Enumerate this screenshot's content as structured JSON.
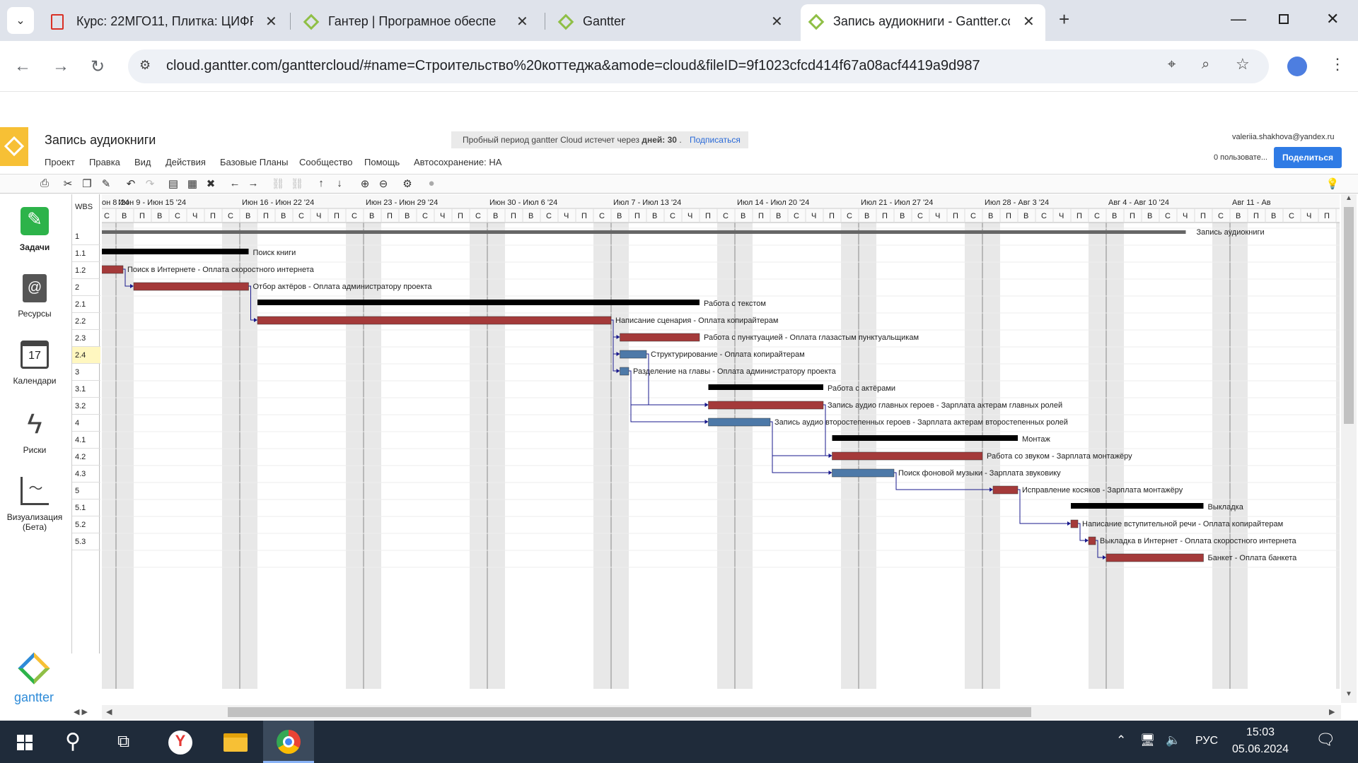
{
  "browser": {
    "tabs": [
      {
        "title": "Курс: 22МГО11, Плитка: ЦИФР",
        "icon": "document-icon"
      },
      {
        "title": "Гантер | Програмное обеспе",
        "icon": "gantter-icon"
      },
      {
        "title": "Gantter",
        "icon": "gantter-icon"
      },
      {
        "title": "Запись аудиокниги - Gantter.co",
        "icon": "gantter-icon"
      }
    ],
    "new_tab": "+",
    "url": "cloud.gantter.com/ganttercloud/#name=Строительство%20коттеджа&amode=cloud&fileID=9f1023cfcd414f67a08acf4419a9d987"
  },
  "app": {
    "title": "Запись аудиокниги",
    "trial_text": "Пробный период gantter Cloud истечет через",
    "trial_days_label": "дней: 30",
    "trial_dot": ".",
    "subscribe": "Подписаться",
    "user_email": "valeriia.shakhova@yandex.ru",
    "users_label": "0 пользовате...",
    "share": "Поделиться",
    "menu": [
      "Проект",
      "Правка",
      "Вид",
      "Действия",
      "Базовые Планы",
      "Сообщество",
      "Помощь"
    ],
    "autosave": "Автосохранение: НА",
    "brand": "gantter"
  },
  "sidenav": [
    {
      "label": "Задачи",
      "icon": "edit-icon"
    },
    {
      "label": "Ресурсы",
      "icon": "contacts-icon"
    },
    {
      "label": "Календари",
      "icon": "calendar-icon",
      "day": "17"
    },
    {
      "label": "Риски",
      "icon": "lightning-icon"
    },
    {
      "label": "Визуализация",
      "label2": "(Бета)",
      "icon": "chart-icon"
    }
  ],
  "wbs": {
    "header": "WBS",
    "rows": [
      "1",
      "1.1",
      "1.2",
      "2",
      "2.1",
      "2.2",
      "2.3",
      "2.4",
      "3",
      "3.1",
      "3.2",
      "4",
      "4.1",
      "4.2",
      "4.3",
      "5",
      "5.1",
      "5.2",
      "5.3"
    ],
    "selected": "2.4"
  },
  "gantt": {
    "weeks": [
      "он 8 '24",
      "Июн 9 - Июн 15 '24",
      "Июн 16 - Июн 22 '24",
      "Июн 23 - Июн 29 '24",
      "Июн 30 - Июл 6 '24",
      "Июл 7 - Июл 13 '24",
      "Июл 14 - Июл 20 '24",
      "Июл 21 - Июл 27 '24",
      "Июл 28 - Авг 3 '24",
      "Авг 4 - Авг 10 '24",
      "Авг 11 - Ав"
    ],
    "day_letters": [
      "В",
      "П",
      "В",
      "С",
      "Ч",
      "П",
      "С"
    ],
    "project_label": "Запись аудиокниги",
    "tasks": [
      {
        "wbs": "1",
        "type": "summary",
        "start": 1,
        "end": 9.5,
        "label": "Поиск книги"
      },
      {
        "wbs": "1.1",
        "type": "task",
        "start": 1,
        "end": 2.4,
        "color": "red",
        "label": "Поиск в Интернете - Оплата скоростного интернета"
      },
      {
        "wbs": "1.2",
        "type": "task",
        "start": 3,
        "end": 9.5,
        "color": "red",
        "label": "Отбор актёров - Оплата администратору проекта"
      },
      {
        "wbs": "2",
        "type": "summary",
        "start": 10,
        "end": 35,
        "label": "Работа с текстом"
      },
      {
        "wbs": "2.1",
        "type": "task",
        "start": 10,
        "end": 30,
        "color": "red",
        "label": "Написание сценария - Оплата копирайтерам"
      },
      {
        "wbs": "2.2",
        "type": "task",
        "start": 30.5,
        "end": 35,
        "color": "red",
        "label": "Работа с пунктуацией - Оплата глазастым пунктуальщикам"
      },
      {
        "wbs": "2.3",
        "type": "task",
        "start": 30.5,
        "end": 32,
        "color": "blue",
        "label": "Структурирование - Оплата копирайтерам"
      },
      {
        "wbs": "2.4",
        "type": "task",
        "start": 30.5,
        "end": 31,
        "color": "blue",
        "label": "Разделение на главы - Оплата администратору проекта"
      },
      {
        "wbs": "3",
        "type": "summary",
        "start": 35.5,
        "end": 42,
        "label": "Работа с актёрами"
      },
      {
        "wbs": "3.1",
        "type": "task",
        "start": 35.5,
        "end": 42,
        "color": "red",
        "label": "Запись аудио главных героев - Зарплата актерам главных ролей"
      },
      {
        "wbs": "3.2",
        "type": "task",
        "start": 35.5,
        "end": 39,
        "color": "blue",
        "label": "Запись аудио второстепенных героев - Зарплата актерам второстепенных ролей"
      },
      {
        "wbs": "4",
        "type": "summary",
        "start": 42.5,
        "end": 53,
        "label": "Монтаж"
      },
      {
        "wbs": "4.1",
        "type": "task",
        "start": 42.5,
        "end": 51,
        "color": "red",
        "label": "Работа со звуком - Зарплата монтажёру"
      },
      {
        "wbs": "4.2",
        "type": "task",
        "start": 42.5,
        "end": 46,
        "color": "blue",
        "label": "Поиск фоновой музыки - Зарплата звуковику"
      },
      {
        "wbs": "4.3",
        "type": "task",
        "start": 51.6,
        "end": 53,
        "color": "red",
        "label": "Исправление косяков - Зарплата монтажёру"
      },
      {
        "wbs": "5",
        "type": "summary",
        "start": 56,
        "end": 63.5,
        "label": "Выкладка"
      },
      {
        "wbs": "5.1",
        "type": "task",
        "start": 56,
        "end": 56.4,
        "color": "red",
        "label": "Написание вступительной речи - Оплата копирайтерам"
      },
      {
        "wbs": "5.2",
        "type": "task",
        "start": 57,
        "end": 57.4,
        "color": "red",
        "label": "Выкладка в Интернет - Оплата скоростного интернета"
      },
      {
        "wbs": "5.3",
        "type": "task",
        "start": 58,
        "end": 63.5,
        "color": "red",
        "label": "Банкет - Оплата банкета"
      }
    ]
  },
  "taskbar": {
    "lang": "РУС",
    "time": "15:03",
    "date": "05.06.2024"
  },
  "colors": {
    "task_red": "#a43a3a",
    "task_blue": "#4d79a8",
    "summary": "#000000",
    "link": "#1a1a8c",
    "weekend": "#e8e8e8",
    "share": "#2f7be5",
    "logo": "#f7c035"
  }
}
